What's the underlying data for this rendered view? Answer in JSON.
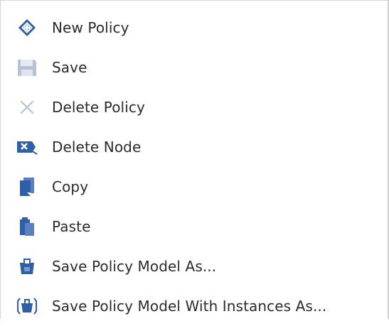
{
  "menu": {
    "items": [
      {
        "label": "New Policy",
        "icon": "new-policy-icon",
        "enabled": true
      },
      {
        "label": "Save",
        "icon": "save-icon",
        "enabled": false
      },
      {
        "label": "Delete Policy",
        "icon": "delete-x-icon",
        "enabled": false
      },
      {
        "label": "Delete Node",
        "icon": "delete-node-icon",
        "enabled": true
      },
      {
        "label": "Copy",
        "icon": "copy-icon",
        "enabled": true
      },
      {
        "label": "Paste",
        "icon": "paste-icon",
        "enabled": true
      },
      {
        "label": "Save Policy Model As...",
        "icon": "save-model-icon",
        "enabled": true
      },
      {
        "label": "Save Policy Model With Instances As...",
        "icon": "save-model-instances-icon",
        "enabled": true
      }
    ]
  },
  "colors": {
    "icon_blue": "#2e5fa8",
    "icon_disabled": "#b7c3d3",
    "text": "#2b2b2b"
  }
}
